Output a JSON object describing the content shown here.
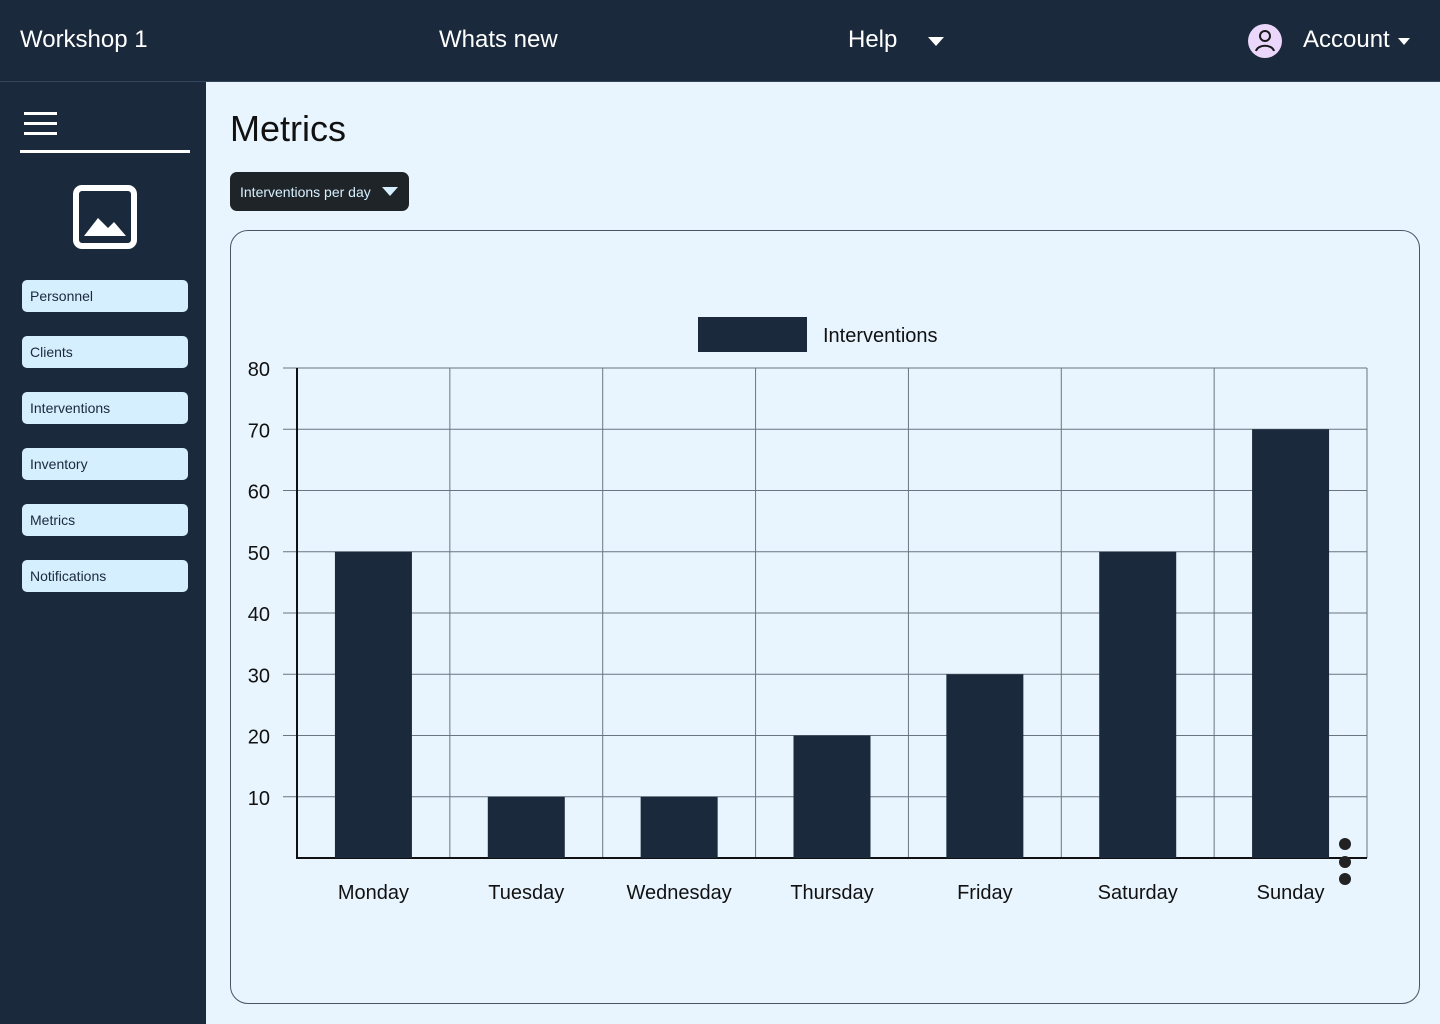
{
  "header": {
    "app_title": "Workshop 1",
    "whats_new": "Whats new",
    "help": "Help",
    "account": "Account"
  },
  "sidebar": {
    "items": [
      {
        "label": "Personnel"
      },
      {
        "label": "Clients"
      },
      {
        "label": "Interventions"
      },
      {
        "label": "Inventory"
      },
      {
        "label": "Metrics"
      },
      {
        "label": "Notifications"
      }
    ]
  },
  "main": {
    "title": "Metrics",
    "dropdown_label": "Interventions per day"
  },
  "colors": {
    "navy": "#1a293b",
    "page_bg": "#e8f5fe",
    "nav_item_bg": "#d6efff",
    "avatar_bg": "#ead7fb"
  },
  "chart_data": {
    "type": "bar",
    "categories": [
      "Monday",
      "Tuesday",
      "Wednesday",
      "Thursday",
      "Friday",
      "Saturday",
      "Sunday"
    ],
    "series": [
      {
        "name": "Interventions",
        "values": [
          50,
          10,
          10,
          20,
          30,
          50,
          70
        ]
      }
    ],
    "y_ticks": [
      10,
      20,
      30,
      40,
      50,
      60,
      70,
      80
    ],
    "ylim": [
      0,
      80
    ],
    "grid": true,
    "legend": "top-center",
    "bar_color": "#1a293b"
  }
}
